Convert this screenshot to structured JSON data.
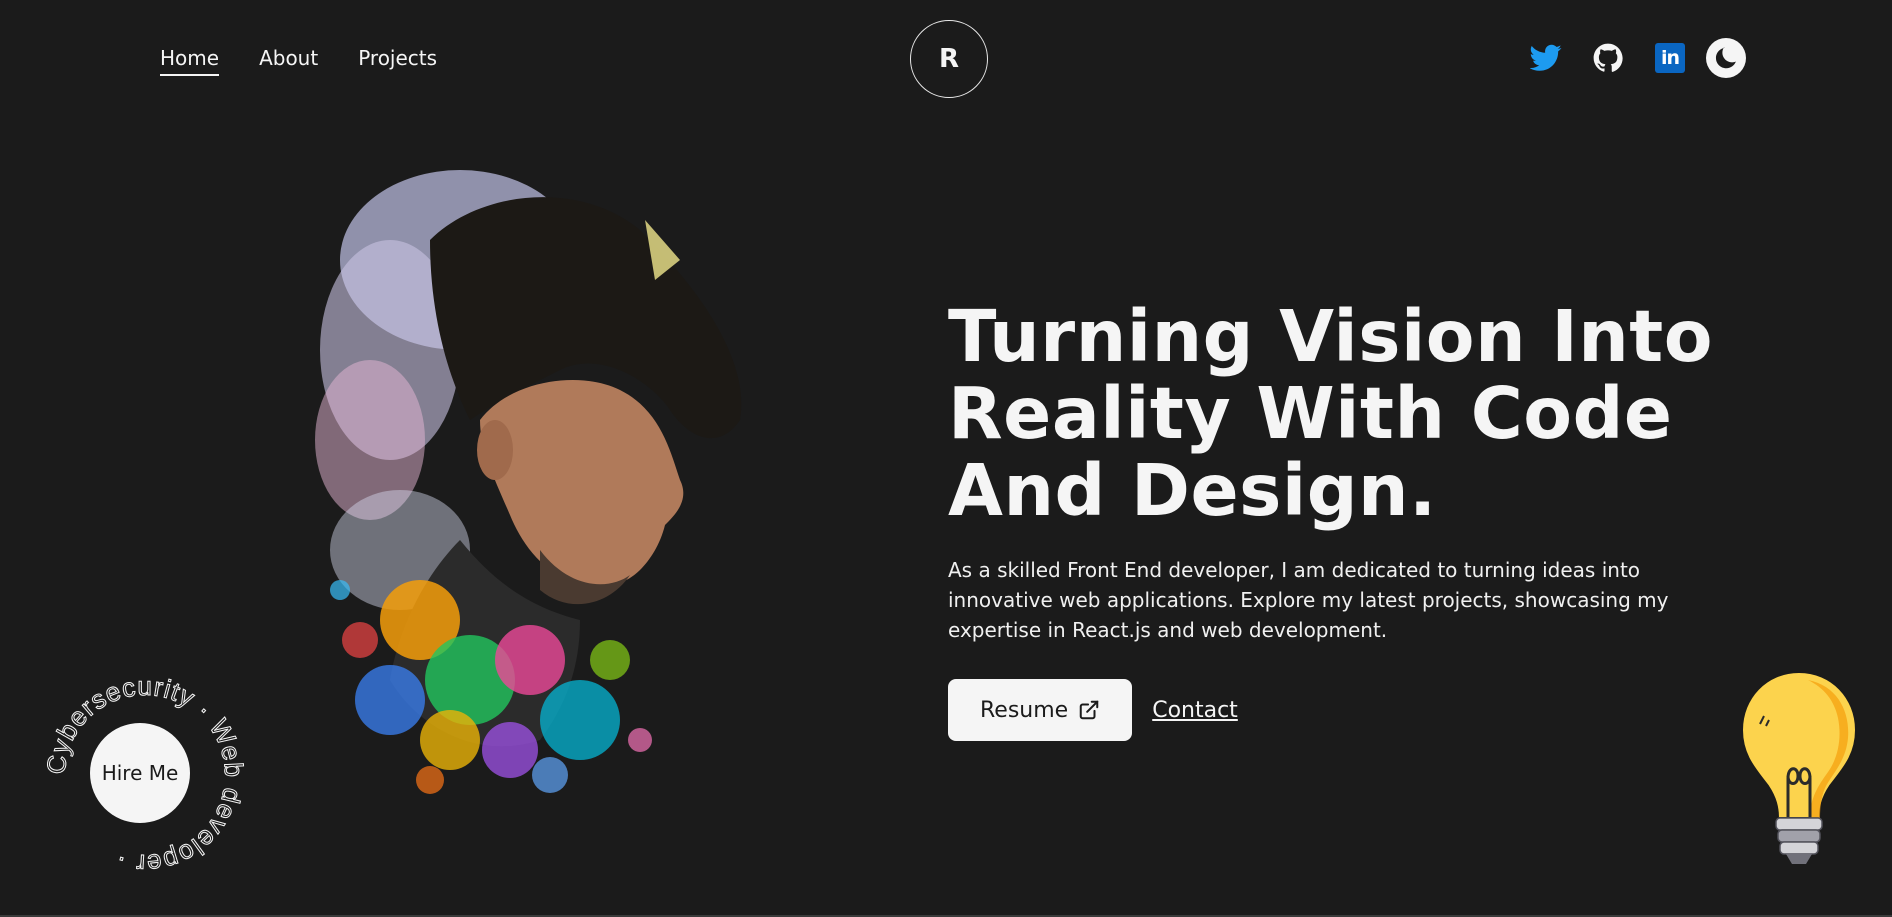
{
  "nav": {
    "items": [
      {
        "label": "Home",
        "active": true
      },
      {
        "label": "About",
        "active": false
      },
      {
        "label": "Projects",
        "active": false
      }
    ]
  },
  "logo": {
    "text": "R"
  },
  "socials": {
    "icons": [
      "twitter-icon",
      "github-icon",
      "linkedin-icon",
      "moon-icon"
    ],
    "linkedin_text": "in"
  },
  "hero": {
    "title": "Turning Vision Into Reality With Code And Design.",
    "description": "As a skilled Front End developer, I am dedicated to turning ideas into innovative web applications. Explore my latest projects, showcasing my expertise in React.js and web development.",
    "resume_label": "Resume",
    "contact_label": "Contact"
  },
  "hire": {
    "button_label": "Hire Me",
    "ring_text": "Cybersecurity · Web developer · "
  },
  "colors": {
    "background": "#1b1b1b",
    "foreground": "#f5f5f5",
    "twitter": "#1d9bf0",
    "linkedin": "#0a66c2",
    "bulb": "#fcd34d"
  }
}
